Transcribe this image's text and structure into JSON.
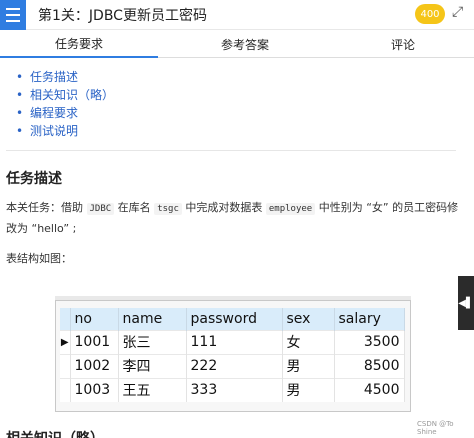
{
  "header": {
    "title": "第1关：JDBC更新员工密码",
    "badge": "400"
  },
  "tabs": [
    {
      "label": "任务要求"
    },
    {
      "label": "参考答案"
    },
    {
      "label": "评论"
    }
  ],
  "toc": [
    "任务描述",
    "相关知识（略）",
    "编程要求",
    "测试说明"
  ],
  "section_task": {
    "heading": "任务描述",
    "text_before_jdbc": "本关任务：借助 ",
    "code_jdbc": "JDBC",
    "text_lib": " 在库名 ",
    "code_tsgc": "tsgc",
    "text_mid": " 中完成对数据表 ",
    "code_employee": "employee",
    "text_after": " 中性别为 “女” 的员工密码修改为 “hello” ;",
    "table_intro": "表结构如图："
  },
  "db_table": {
    "columns": [
      "no",
      "name",
      "password",
      "sex",
      "salary"
    ],
    "rows": [
      [
        "1001",
        "张三",
        "111",
        "女",
        "3500"
      ],
      [
        "1002",
        "李四",
        "222",
        "男",
        "8500"
      ],
      [
        "1003",
        "王五",
        "333",
        "男",
        "4500"
      ]
    ]
  },
  "section_knowledge": {
    "heading": "相关知识（略）"
  },
  "watermark": "CSDN @To Shine"
}
